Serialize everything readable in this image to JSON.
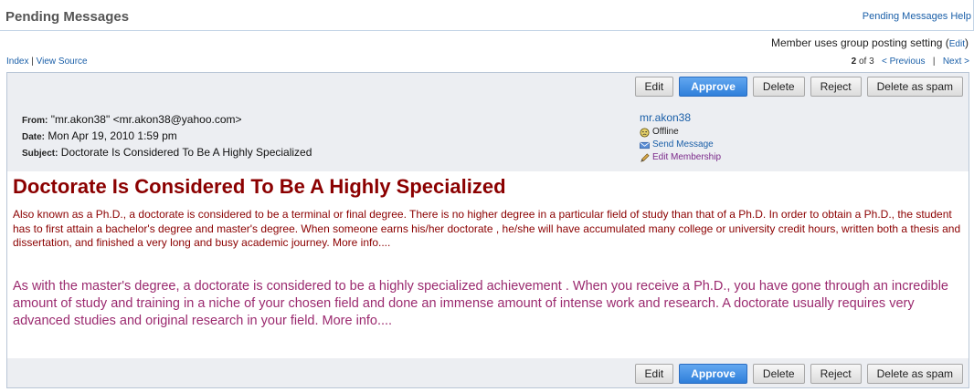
{
  "header": {
    "title": "Pending Messages",
    "help_link": "Pending Messages Help"
  },
  "posting": {
    "text": "Member uses group posting setting",
    "open_paren": "(",
    "edit_label": "Edit",
    "close_paren": ")"
  },
  "nav": {
    "index": "Index",
    "separator": "|",
    "view_source": "View Source",
    "current": "2",
    "of_total": "of 3",
    "previous": "< Previous",
    "next_sep": "|",
    "next": "Next >"
  },
  "actions": {
    "edit": "Edit",
    "approve": "Approve",
    "delete": "Delete",
    "reject": "Reject",
    "spam": "Delete as spam"
  },
  "message": {
    "from_label": "From:",
    "from_value": "\"mr.akon38\" <mr.akon38@yahoo.com>",
    "date_label": "Date:",
    "date_value": "Mon Apr 19, 2010 1:59 pm",
    "subject_label": "Subject:",
    "subject_value": "Doctorate Is Considered To Be A Highly Specialized"
  },
  "member": {
    "name": "mr.akon38",
    "status": "Offline",
    "send_message": "Send Message",
    "edit_membership": "Edit Membership"
  },
  "body": {
    "heading": "Doctorate Is Considered To Be A Highly Specialized",
    "paragraph1": "Also known as a Ph.D., a doctorate is considered  to be a terminal or final degree. There is no higher degree in a particular field of study than that of a Ph.D. In order to obtain a Ph.D., the student has to first attain a bachelor's degree  and master's degree. When someone earns his/her doctorate , he/she will have accumulated many college or university credit hours, written both a thesis and dissertation, and finished a very long  and busy academic journey.  More info....",
    "paragraph2": "As with the master's degree, a doctorate is considered  to be a highly specialized achievement . When you receive a Ph.D., you have gone through an incredible amount of study and training  in a niche of your chosen field and done an immense amount of intense work and research. A doctorate usually requires very advanced  studies and original research in your field.  More info...."
  },
  "colors": {
    "heading": "#8b0000",
    "paragraph2": "#9b2a6f",
    "link": "#1a5fa8",
    "approve": "#2f7fda"
  },
  "icons": [
    "status-offline-icon",
    "envelope-icon",
    "pencil-icon"
  ]
}
